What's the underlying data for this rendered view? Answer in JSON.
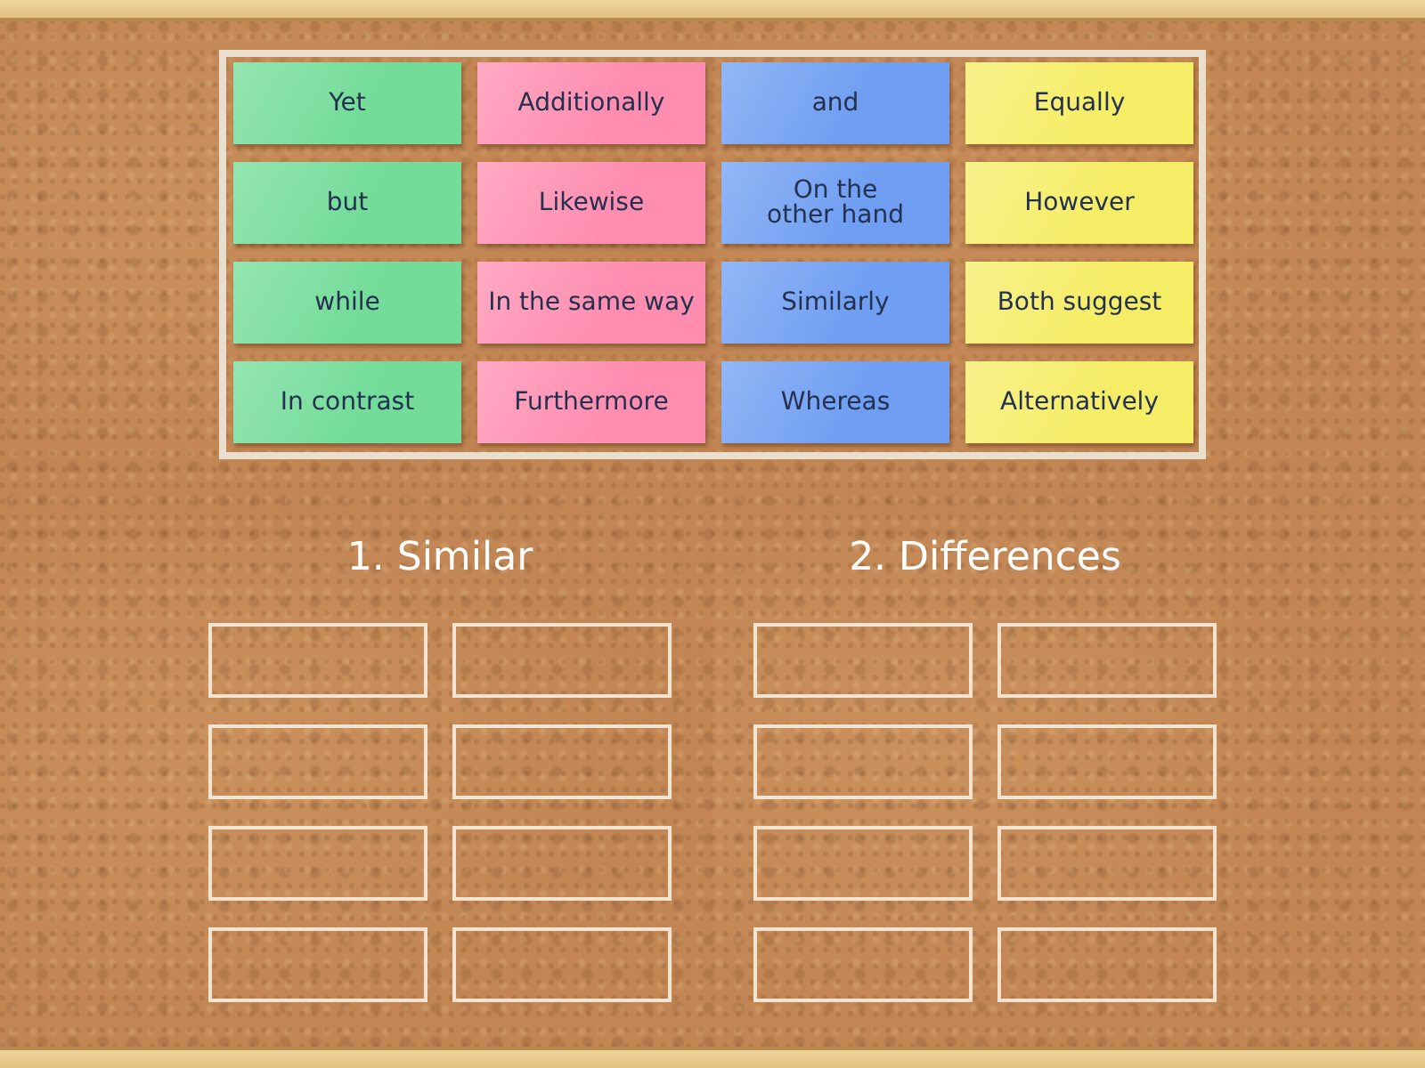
{
  "cards": [
    {
      "label": "Yet",
      "color": "#72dc98"
    },
    {
      "label": "Additionally",
      "color": "#ff8db0"
    },
    {
      "label": "and",
      "color": "#6f9ef2"
    },
    {
      "label": "Equally",
      "color": "#f6ed66"
    },
    {
      "label": "but",
      "color": "#72dc98"
    },
    {
      "label": "Likewise",
      "color": "#ff8db0"
    },
    {
      "label": "On the\nother hand",
      "color": "#6f9ef2"
    },
    {
      "label": "However",
      "color": "#f6ed66"
    },
    {
      "label": "while",
      "color": "#72dc98"
    },
    {
      "label": "In the same way",
      "color": "#ff8db0"
    },
    {
      "label": "Similarly",
      "color": "#6f9ef2"
    },
    {
      "label": "Both suggest",
      "color": "#f6ed66"
    },
    {
      "label": "In contrast",
      "color": "#72dc98"
    },
    {
      "label": "Furthermore",
      "color": "#ff8db0"
    },
    {
      "label": "Whereas",
      "color": "#6f9ef2"
    },
    {
      "label": "Alternatively",
      "color": "#f6ed66"
    }
  ],
  "groups": [
    {
      "title": "1. Similar",
      "slots": [
        {
          "kind": "empty"
        },
        {
          "kind": "empty"
        },
        {
          "kind": "empty"
        },
        {
          "kind": "empty"
        },
        {
          "kind": "empty"
        },
        {
          "kind": "empty"
        },
        {
          "kind": "empty"
        },
        {
          "kind": "empty"
        }
      ]
    },
    {
      "title": "2. Differences",
      "slots": [
        {
          "kind": "empty"
        },
        {
          "kind": "empty"
        },
        {
          "kind": "empty"
        },
        {
          "kind": "empty"
        },
        {
          "kind": "empty"
        },
        {
          "kind": "empty"
        },
        {
          "kind": "empty"
        },
        {
          "kind": "empty"
        }
      ]
    }
  ]
}
